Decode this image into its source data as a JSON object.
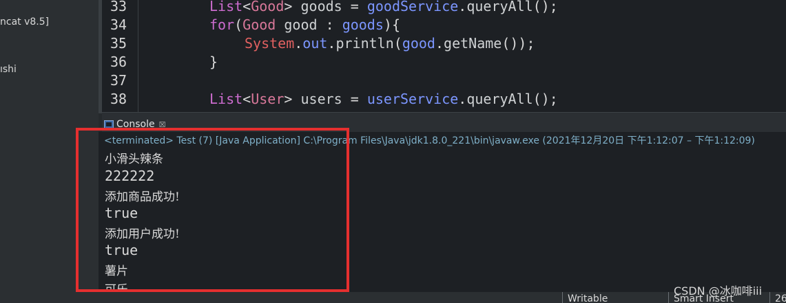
{
  "left_panel": {
    "items": [
      "ncat v8.5]",
      "ıshi"
    ]
  },
  "editor": {
    "lines": [
      {
        "num": "33",
        "tokens": [
          {
            "t": "List",
            "c": "kw"
          },
          {
            "t": "<",
            "c": "plain"
          },
          {
            "t": "Good",
            "c": "ty"
          },
          {
            "t": "> ",
            "c": "plain"
          },
          {
            "t": "goods",
            "c": "fn"
          },
          {
            "t": " = ",
            "c": "plain"
          },
          {
            "t": "goodService",
            "c": "var"
          },
          {
            "t": ".",
            "c": "plain"
          },
          {
            "t": "queryAll",
            "c": "fn"
          },
          {
            "t": "();",
            "c": "plain"
          }
        ]
      },
      {
        "num": "34",
        "tokens": [
          {
            "t": "for",
            "c": "kw"
          },
          {
            "t": "(",
            "c": "plain"
          },
          {
            "t": "Good",
            "c": "ty"
          },
          {
            "t": " ",
            "c": "plain"
          },
          {
            "t": "good",
            "c": "fn"
          },
          {
            "t": " : ",
            "c": "plain"
          },
          {
            "t": "goods",
            "c": "var"
          },
          {
            "t": "){",
            "c": "plain"
          }
        ]
      },
      {
        "num": "35",
        "indent": "    ",
        "tokens": [
          {
            "t": "System",
            "c": "cls"
          },
          {
            "t": ".",
            "c": "plain"
          },
          {
            "t": "out",
            "c": "var"
          },
          {
            "t": ".",
            "c": "plain"
          },
          {
            "t": "println",
            "c": "fn"
          },
          {
            "t": "(",
            "c": "plain"
          },
          {
            "t": "good",
            "c": "var"
          },
          {
            "t": ".",
            "c": "plain"
          },
          {
            "t": "getName",
            "c": "fn"
          },
          {
            "t": "());",
            "c": "plain"
          }
        ]
      },
      {
        "num": "36",
        "tokens": [
          {
            "t": "}",
            "c": "plain"
          }
        ]
      },
      {
        "num": "37",
        "tokens": []
      },
      {
        "num": "38",
        "tokens": [
          {
            "t": "List",
            "c": "kw"
          },
          {
            "t": "<",
            "c": "plain"
          },
          {
            "t": "User",
            "c": "ty"
          },
          {
            "t": "> ",
            "c": "plain"
          },
          {
            "t": "users",
            "c": "fn"
          },
          {
            "t": " = ",
            "c": "plain"
          },
          {
            "t": "userService",
            "c": "var"
          },
          {
            "t": ".",
            "c": "plain"
          },
          {
            "t": "queryAll",
            "c": "fn"
          },
          {
            "t": "();",
            "c": "plain"
          }
        ]
      }
    ]
  },
  "console": {
    "tab_label": "Console",
    "close_glyph": "☒",
    "terminated": "<terminated> Test (7) [Java Application] C:\\Program Files\\Java\\jdk1.8.0_221\\bin\\javaw.exe  (2021年12月20日 下午1:12:07 – 下午1:12:09)",
    "output": [
      {
        "text": "小滑头辣条",
        "kind": "cn"
      },
      {
        "text": "222222",
        "kind": "num"
      },
      {
        "text": "添加商品成功!",
        "kind": "cn"
      },
      {
        "text": "true",
        "kind": "num"
      },
      {
        "text": "添加用户成功!",
        "kind": "cn"
      },
      {
        "text": "true",
        "kind": "num"
      },
      {
        "text": "薯片",
        "kind": "cn"
      },
      {
        "text": "可乐",
        "kind": "cn"
      }
    ]
  },
  "statusbar": {
    "writable": "Writable",
    "insert_mode": "Smart Insert",
    "position": "26"
  },
  "watermark": "CSDN @冰咖啡iii",
  "colors": {
    "highlight_box": "#e52f2f",
    "keyword": "#cc6ccf",
    "type": "#d9789a",
    "variable": "#7c96ff",
    "terminated_text": "#7fb0c9"
  },
  "icons": {
    "console_tab": "console-icon"
  }
}
